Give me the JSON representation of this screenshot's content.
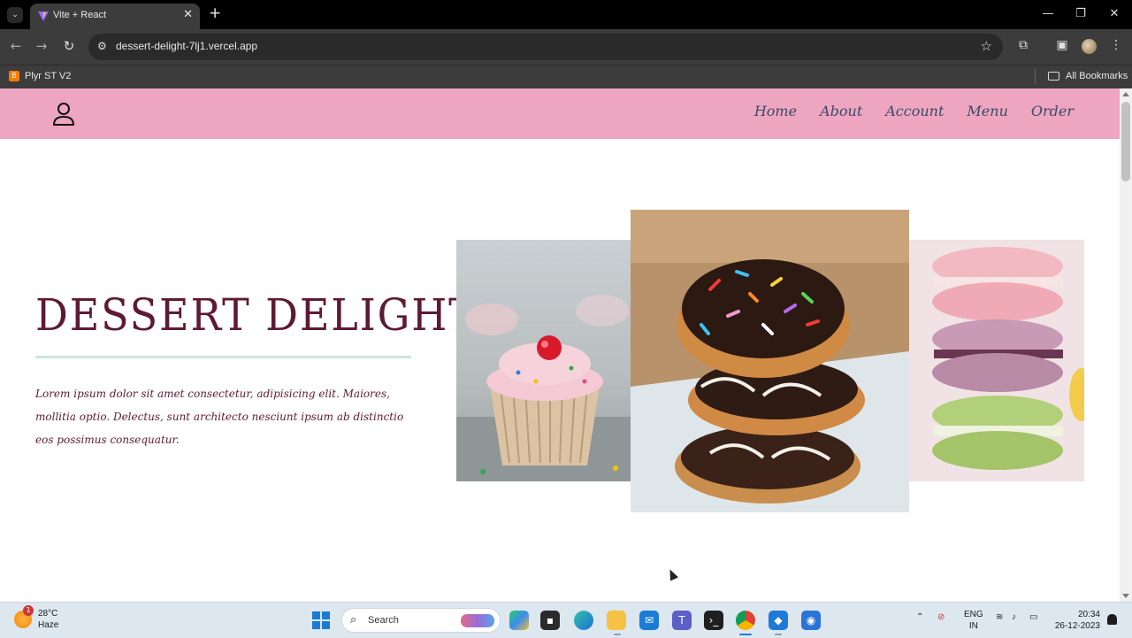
{
  "browser": {
    "tab_title": "Vite + React",
    "tab_close": "✕",
    "new_tab": "+",
    "url": "dessert-delight-7lj1.vercel.app",
    "bookmark": "Plyr ST V2",
    "all_bookmarks": "All Bookmarks",
    "window_controls": {
      "minimize": "—",
      "maximize": "❐",
      "close": "✕"
    }
  },
  "site": {
    "nav": [
      "Home",
      "About",
      "Account",
      "Menu",
      "Order"
    ],
    "hero": {
      "title": "DESSERT DELIGHT",
      "paragraph": "Lorem ipsum dolor sit amet consectetur, adipisicing elit. Maiores, mollitia optio. Delectus, sunt architecto nesciunt ipsum ab distinctio eos possimus consequatur."
    },
    "colors": {
      "header_bg": "#eea6c0",
      "nav_text": "#3a4a68",
      "title_text": "#5e1a33",
      "divider": "#cfe6e1"
    },
    "images": [
      "cupcake",
      "sprinkle-donuts-stack",
      "macarons-stack"
    ]
  },
  "taskbar": {
    "weather": {
      "temp": "28°C",
      "condition": "Haze",
      "badge": "1"
    },
    "search_placeholder": "Search",
    "language": {
      "line1": "ENG",
      "line2": "IN"
    },
    "clock": {
      "time": "20:34",
      "date": "26-12-2023"
    }
  }
}
